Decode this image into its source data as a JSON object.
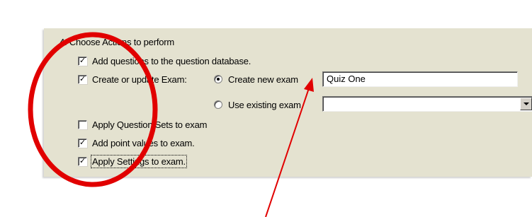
{
  "section": {
    "step_title": "4. Choose Actions to perform"
  },
  "actions": {
    "add_questions": {
      "label": "Add questions to the question database.",
      "checked": true
    },
    "create_update_exam": {
      "label": "Create or update Exam:",
      "checked": true
    },
    "apply_question_sets": {
      "label": "Apply Question Sets to exam",
      "checked": false
    },
    "add_point_values": {
      "label": "Add point values to exam.",
      "checked": true
    },
    "apply_settings": {
      "label": "Apply Settings to exam.",
      "checked": true
    }
  },
  "exam_mode": {
    "create_new": {
      "label": "Create new exam",
      "selected": true
    },
    "use_existing": {
      "label": "Use existing exam",
      "selected": false
    }
  },
  "new_exam_name": {
    "value": "Quiz One"
  },
  "existing_exam_select": {
    "selected_value": ""
  },
  "annotations": {
    "circle_color": "#e10000",
    "arrow_color": "#e10000"
  },
  "colors": {
    "panel_background": "#e4e2d0"
  }
}
